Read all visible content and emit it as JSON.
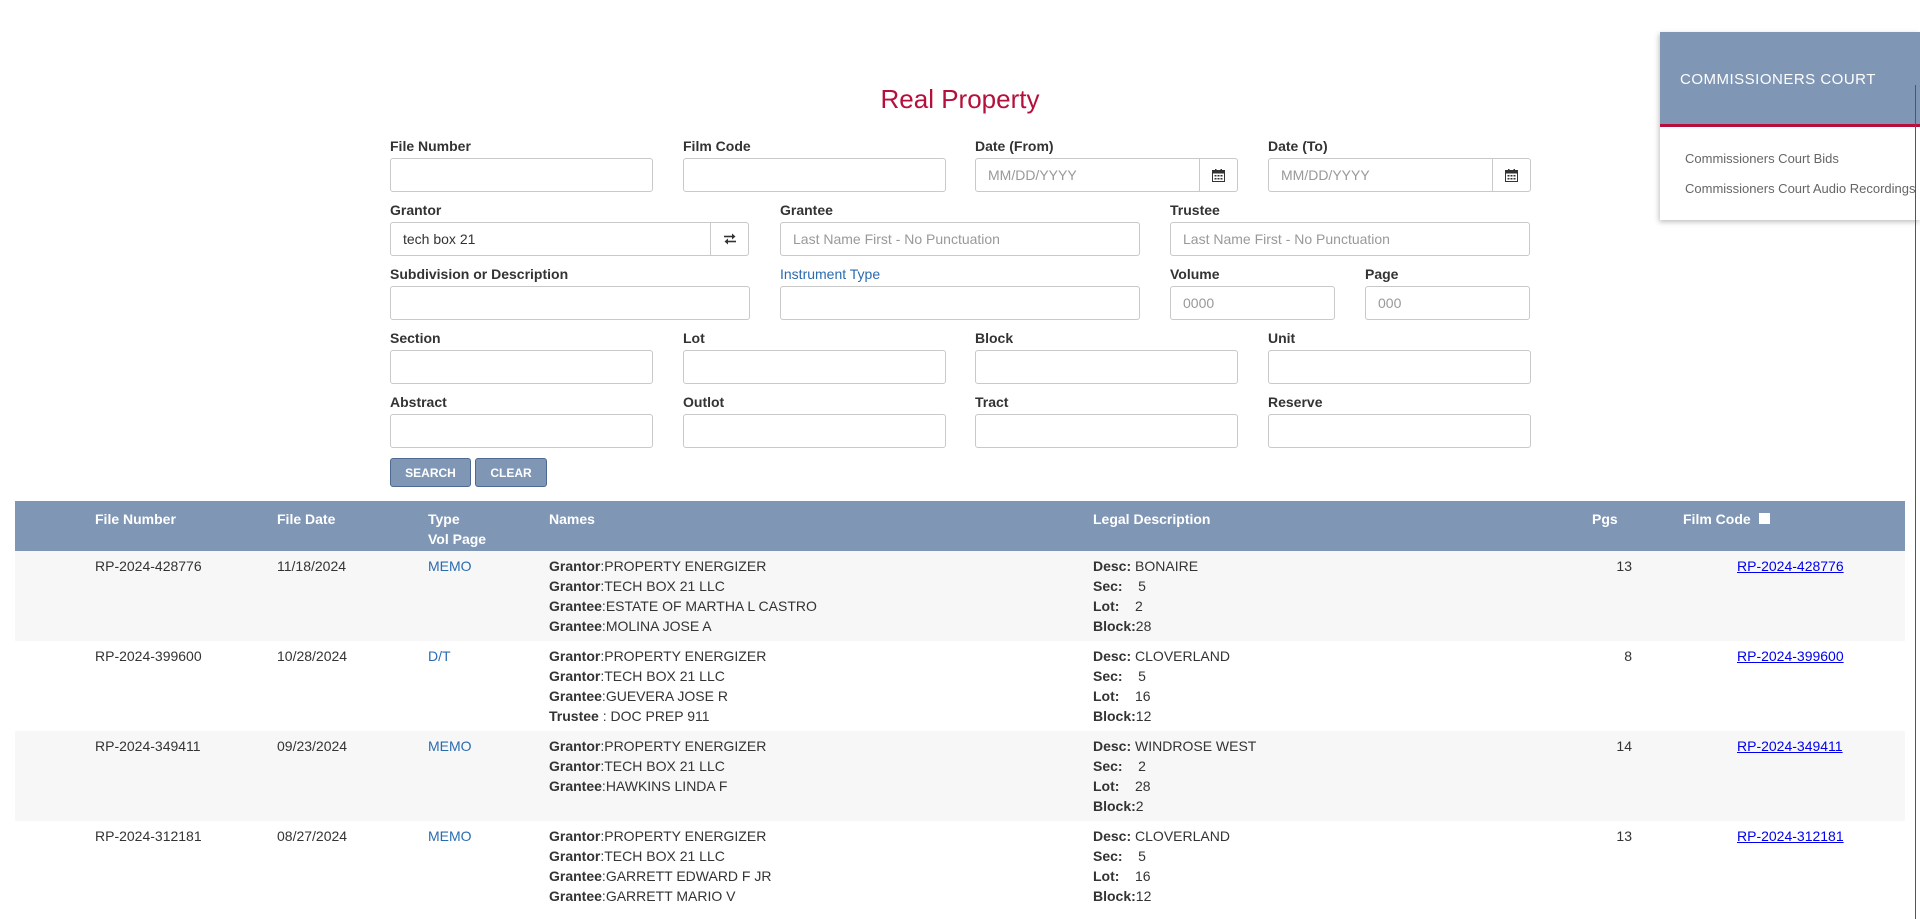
{
  "page": {
    "title": "Real Property"
  },
  "form": {
    "file_number_label": "File Number",
    "film_code_label": "Film Code",
    "date_from_label": "Date (From)",
    "date_from_placeholder": "MM/DD/YYYY",
    "date_to_label": "Date (To)",
    "date_to_placeholder": "MM/DD/YYYY",
    "grantor_label": "Grantor",
    "grantor_value": "tech box 21",
    "grantee_label": "Grantee",
    "grantee_placeholder": "Last Name First - No Punctuation",
    "trustee_label": "Trustee",
    "trustee_placeholder": "Last Name First - No Punctuation",
    "subdivision_label": "Subdivision or Description",
    "instrument_type_label": "Instrument Type",
    "volume_label": "Volume",
    "volume_placeholder": "0000",
    "page_label": "Page",
    "page_placeholder": "000",
    "section_label": "Section",
    "lot_label": "Lot",
    "block_label": "Block",
    "unit_label": "Unit",
    "abstract_label": "Abstract",
    "outlot_label": "Outlot",
    "tract_label": "Tract",
    "reserve_label": "Reserve",
    "search_label": "SEARCH",
    "clear_label": "CLEAR",
    "icons": {
      "calendar": "calendar-icon",
      "swap": "swap-icon"
    }
  },
  "results": {
    "headers": {
      "file_number": "File Number",
      "file_date": "File Date",
      "type": "Type",
      "vol_page": "Vol Page",
      "names": "Names",
      "legal_description": "Legal Description",
      "pgs": "Pgs",
      "film_code": "Film Code"
    },
    "rows": [
      {
        "file_number": "RP-2024-428776",
        "file_date": "11/18/2024",
        "type": "MEMO",
        "names": [
          {
            "role": "Grantor",
            "name": "PROPERTY ENERGIZER"
          },
          {
            "role": "Grantor",
            "name": "TECH BOX 21 LLC"
          },
          {
            "role": "Grantee",
            "name": "ESTATE OF MARTHA L CASTRO"
          },
          {
            "role": "Grantee",
            "name": "MOLINA JOSE A"
          }
        ],
        "legal": {
          "desc": "BONAIRE",
          "sec": "5",
          "lot": "2",
          "block": "28"
        },
        "pgs": "13",
        "film_code": "RP-2024-428776"
      },
      {
        "file_number": "RP-2024-399600",
        "file_date": "10/28/2024",
        "type": "D/T",
        "names": [
          {
            "role": "Grantor",
            "name": "PROPERTY ENERGIZER"
          },
          {
            "role": "Grantor",
            "name": "TECH BOX 21 LLC"
          },
          {
            "role": "Grantee",
            "name": "GUEVERA JOSE R"
          },
          {
            "role": "Trustee ",
            "name": "DOC PREP 911"
          }
        ],
        "legal": {
          "desc": "CLOVERLAND",
          "sec": "5",
          "lot": "16",
          "block": "12"
        },
        "pgs": "8",
        "film_code": "RP-2024-399600"
      },
      {
        "file_number": "RP-2024-349411",
        "file_date": "09/23/2024",
        "type": "MEMO",
        "names": [
          {
            "role": "Grantor",
            "name": "PROPERTY ENERGIZER"
          },
          {
            "role": "Grantor",
            "name": "TECH BOX 21 LLC"
          },
          {
            "role": "Grantee",
            "name": "HAWKINS LINDA F"
          }
        ],
        "legal": {
          "desc": "WINDROSE WEST",
          "sec": "2",
          "lot": "28",
          "block": "2"
        },
        "pgs": "14",
        "film_code": "RP-2024-349411"
      },
      {
        "file_number": "RP-2024-312181",
        "file_date": "08/27/2024",
        "type": "MEMO",
        "names": [
          {
            "role": "Grantor",
            "name": "PROPERTY ENERGIZER"
          },
          {
            "role": "Grantor",
            "name": "TECH BOX 21 LLC"
          },
          {
            "role": "Grantee",
            "name": "GARRETT EDWARD F JR"
          },
          {
            "role": "Grantee",
            "name": "GARRETT MARIO V"
          }
        ],
        "legal": {
          "desc": "CLOVERLAND",
          "sec": "5",
          "lot": "16",
          "block": "12"
        },
        "pgs": "13",
        "film_code": "RP-2024-312181"
      }
    ]
  },
  "side_panel": {
    "title": "COMMISSIONERS COURT",
    "items": [
      {
        "label": "Commissioners Court Bids"
      },
      {
        "label": "Commissioners Court Audio Recordings"
      }
    ]
  },
  "colors": {
    "accent": "#b5103c",
    "header_bg": "#7f96b5",
    "link": "#2a6bb0",
    "film_link": "#0000ee"
  }
}
